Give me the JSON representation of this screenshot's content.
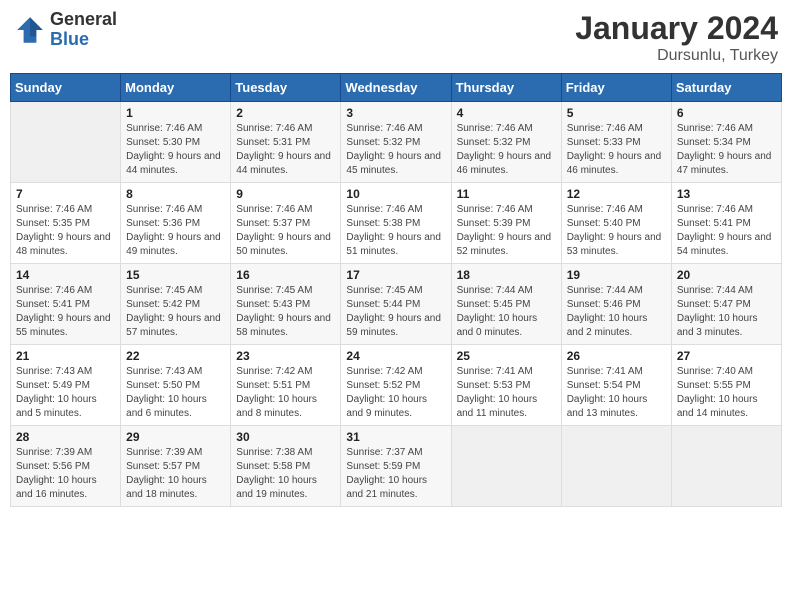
{
  "header": {
    "logo_general": "General",
    "logo_blue": "Blue",
    "month_year": "January 2024",
    "location": "Dursunlu, Turkey"
  },
  "days_of_week": [
    "Sunday",
    "Monday",
    "Tuesday",
    "Wednesday",
    "Thursday",
    "Friday",
    "Saturday"
  ],
  "weeks": [
    [
      {
        "day": "",
        "sunrise": "",
        "sunset": "",
        "daylight": ""
      },
      {
        "day": "1",
        "sunrise": "7:46 AM",
        "sunset": "5:30 PM",
        "daylight": "9 hours and 44 minutes."
      },
      {
        "day": "2",
        "sunrise": "7:46 AM",
        "sunset": "5:31 PM",
        "daylight": "9 hours and 44 minutes."
      },
      {
        "day": "3",
        "sunrise": "7:46 AM",
        "sunset": "5:32 PM",
        "daylight": "9 hours and 45 minutes."
      },
      {
        "day": "4",
        "sunrise": "7:46 AM",
        "sunset": "5:32 PM",
        "daylight": "9 hours and 46 minutes."
      },
      {
        "day": "5",
        "sunrise": "7:46 AM",
        "sunset": "5:33 PM",
        "daylight": "9 hours and 46 minutes."
      },
      {
        "day": "6",
        "sunrise": "7:46 AM",
        "sunset": "5:34 PM",
        "daylight": "9 hours and 47 minutes."
      }
    ],
    [
      {
        "day": "7",
        "sunrise": "7:46 AM",
        "sunset": "5:35 PM",
        "daylight": "9 hours and 48 minutes."
      },
      {
        "day": "8",
        "sunrise": "7:46 AM",
        "sunset": "5:36 PM",
        "daylight": "9 hours and 49 minutes."
      },
      {
        "day": "9",
        "sunrise": "7:46 AM",
        "sunset": "5:37 PM",
        "daylight": "9 hours and 50 minutes."
      },
      {
        "day": "10",
        "sunrise": "7:46 AM",
        "sunset": "5:38 PM",
        "daylight": "9 hours and 51 minutes."
      },
      {
        "day": "11",
        "sunrise": "7:46 AM",
        "sunset": "5:39 PM",
        "daylight": "9 hours and 52 minutes."
      },
      {
        "day": "12",
        "sunrise": "7:46 AM",
        "sunset": "5:40 PM",
        "daylight": "9 hours and 53 minutes."
      },
      {
        "day": "13",
        "sunrise": "7:46 AM",
        "sunset": "5:41 PM",
        "daylight": "9 hours and 54 minutes."
      }
    ],
    [
      {
        "day": "14",
        "sunrise": "7:46 AM",
        "sunset": "5:41 PM",
        "daylight": "9 hours and 55 minutes."
      },
      {
        "day": "15",
        "sunrise": "7:45 AM",
        "sunset": "5:42 PM",
        "daylight": "9 hours and 57 minutes."
      },
      {
        "day": "16",
        "sunrise": "7:45 AM",
        "sunset": "5:43 PM",
        "daylight": "9 hours and 58 minutes."
      },
      {
        "day": "17",
        "sunrise": "7:45 AM",
        "sunset": "5:44 PM",
        "daylight": "9 hours and 59 minutes."
      },
      {
        "day": "18",
        "sunrise": "7:44 AM",
        "sunset": "5:45 PM",
        "daylight": "10 hours and 0 minutes."
      },
      {
        "day": "19",
        "sunrise": "7:44 AM",
        "sunset": "5:46 PM",
        "daylight": "10 hours and 2 minutes."
      },
      {
        "day": "20",
        "sunrise": "7:44 AM",
        "sunset": "5:47 PM",
        "daylight": "10 hours and 3 minutes."
      }
    ],
    [
      {
        "day": "21",
        "sunrise": "7:43 AM",
        "sunset": "5:49 PM",
        "daylight": "10 hours and 5 minutes."
      },
      {
        "day": "22",
        "sunrise": "7:43 AM",
        "sunset": "5:50 PM",
        "daylight": "10 hours and 6 minutes."
      },
      {
        "day": "23",
        "sunrise": "7:42 AM",
        "sunset": "5:51 PM",
        "daylight": "10 hours and 8 minutes."
      },
      {
        "day": "24",
        "sunrise": "7:42 AM",
        "sunset": "5:52 PM",
        "daylight": "10 hours and 9 minutes."
      },
      {
        "day": "25",
        "sunrise": "7:41 AM",
        "sunset": "5:53 PM",
        "daylight": "10 hours and 11 minutes."
      },
      {
        "day": "26",
        "sunrise": "7:41 AM",
        "sunset": "5:54 PM",
        "daylight": "10 hours and 13 minutes."
      },
      {
        "day": "27",
        "sunrise": "7:40 AM",
        "sunset": "5:55 PM",
        "daylight": "10 hours and 14 minutes."
      }
    ],
    [
      {
        "day": "28",
        "sunrise": "7:39 AM",
        "sunset": "5:56 PM",
        "daylight": "10 hours and 16 minutes."
      },
      {
        "day": "29",
        "sunrise": "7:39 AM",
        "sunset": "5:57 PM",
        "daylight": "10 hours and 18 minutes."
      },
      {
        "day": "30",
        "sunrise": "7:38 AM",
        "sunset": "5:58 PM",
        "daylight": "10 hours and 19 minutes."
      },
      {
        "day": "31",
        "sunrise": "7:37 AM",
        "sunset": "5:59 PM",
        "daylight": "10 hours and 21 minutes."
      },
      {
        "day": "",
        "sunrise": "",
        "sunset": "",
        "daylight": ""
      },
      {
        "day": "",
        "sunrise": "",
        "sunset": "",
        "daylight": ""
      },
      {
        "day": "",
        "sunrise": "",
        "sunset": "",
        "daylight": ""
      }
    ]
  ]
}
